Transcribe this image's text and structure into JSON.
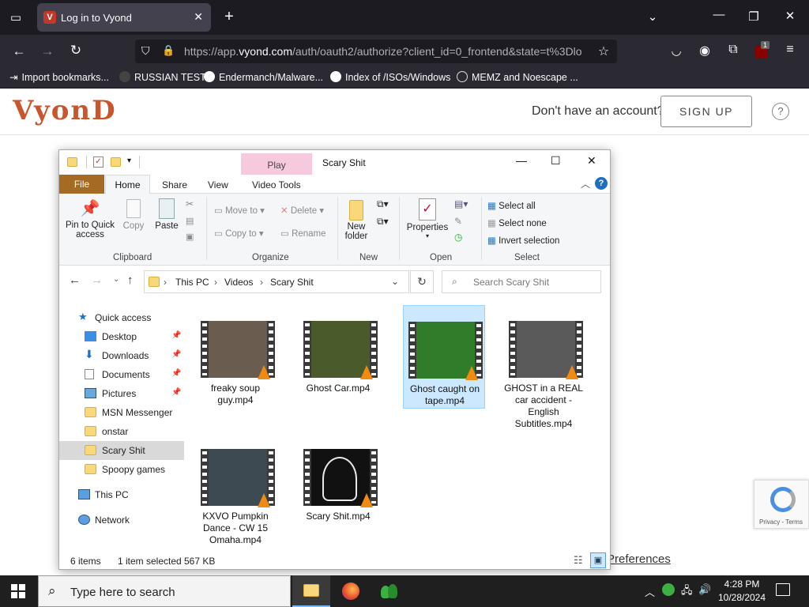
{
  "browser": {
    "tab_title": "Log in to Vyond",
    "tab_favicon": "V",
    "url_prefix": "https://app.",
    "url_domain": "vyond.com",
    "url_rest": "/auth/oauth2/authorize?client_id=0_frontend&state=t%3Dlo",
    "extension_badge": "1",
    "bookmarks": [
      {
        "label": "Import bookmarks..."
      },
      {
        "label": "RUSSIAN TEST"
      },
      {
        "label": "Endermanch/Malware..."
      },
      {
        "label": "Index of /ISOs/Windows"
      },
      {
        "label": "MEMZ and Noescape ..."
      }
    ]
  },
  "vyond": {
    "logo": "VyonD",
    "no_account": "Don't have an account?",
    "signup": "SIGN UP",
    "help": "?",
    "preferences": "Preferences",
    "recaptcha": "Privacy - Terms"
  },
  "explorer": {
    "context_tab": "Play",
    "title": "Scary Shit",
    "tabs": {
      "file": "File",
      "home": "Home",
      "share": "Share",
      "view": "View",
      "video_tools": "Video Tools"
    },
    "ribbon": {
      "pin": "Pin to Quick access",
      "copy": "Copy",
      "paste": "Paste",
      "move_to": "Move to",
      "copy_to": "Copy to",
      "delete": "Delete",
      "rename": "Rename",
      "new_folder": "New folder",
      "properties": "Properties",
      "select_all": "Select all",
      "select_none": "Select none",
      "invert_selection": "Invert selection",
      "groups": {
        "clipboard": "Clipboard",
        "organize": "Organize",
        "new": "New",
        "open": "Open",
        "select": "Select"
      }
    },
    "breadcrumb": [
      "This PC",
      "Videos",
      "Scary Shit"
    ],
    "search_placeholder": "Search Scary Shit",
    "nav": {
      "quick_access": "Quick access",
      "items": [
        {
          "label": "Desktop",
          "pinned": true
        },
        {
          "label": "Downloads",
          "pinned": true
        },
        {
          "label": "Documents",
          "pinned": true
        },
        {
          "label": "Pictures",
          "pinned": true
        },
        {
          "label": "MSN Messenger"
        },
        {
          "label": "onstar"
        },
        {
          "label": "Scary Shit",
          "selected": true
        },
        {
          "label": "Spoopy games"
        }
      ],
      "this_pc": "This PC",
      "network": "Network"
    },
    "files": [
      {
        "name": "freaky soup guy.mp4",
        "color": "#6a5d50"
      },
      {
        "name": "Ghost Car.mp4",
        "color": "#4a5a2a"
      },
      {
        "name": "Ghost caught on tape.mp4",
        "color": "#2f7d2a",
        "selected": true
      },
      {
        "name": "GHOST in a REAL car accident - English Subtitles.mp4",
        "color": "#5a5a5a"
      },
      {
        "name": "KXVO Pumpkin Dance - CW 15 Omaha.mp4",
        "color": "#3d4a52"
      },
      {
        "name": "Scary Shit.mp4",
        "color": "#e8e8e8"
      }
    ],
    "status": {
      "count": "6 items",
      "selected": "1 item selected",
      "size": "567 KB"
    }
  },
  "taskbar": {
    "search_placeholder": "Type here to search",
    "time": "4:28 PM",
    "date": "10/28/2024"
  },
  "colors": {
    "file_tab": "#a56a23",
    "selection": "#cce8ff",
    "vyond_brand": "#c8552d"
  }
}
